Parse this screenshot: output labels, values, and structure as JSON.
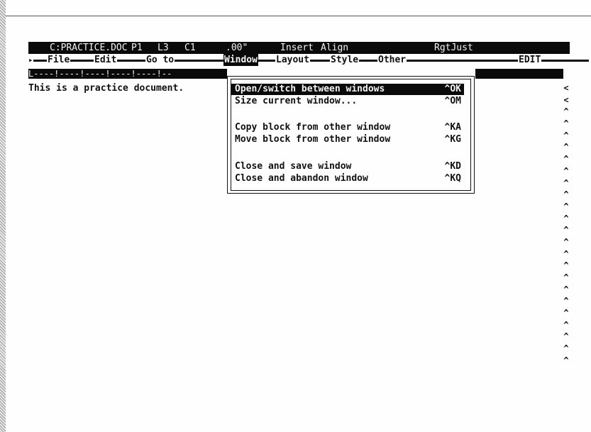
{
  "status_bar": {
    "file": "C:PRACTICE.DOC",
    "page": "P1",
    "line": "L3",
    "column": "C1",
    "position": ".00\"",
    "mode_insert": "Insert",
    "mode_align": "Align",
    "justify": "RgtJust"
  },
  "menu": {
    "start_marker": "▸",
    "items": [
      "File",
      "Edit",
      "Go to",
      "Window",
      "Layout",
      "Style",
      "Other"
    ],
    "active_index": 3,
    "mode_label": "EDIT"
  },
  "ruler": {
    "text": "L----!----!----!----!----!--"
  },
  "document": {
    "text": "This is a practice document."
  },
  "dropdown": {
    "items": [
      {
        "label": "Open/switch between windows",
        "shortcut": "^OK",
        "selected": true
      },
      {
        "label": "Size current window...",
        "shortcut": "^OM",
        "selected": false
      },
      {
        "label": "Copy block from other window",
        "shortcut": "^KA",
        "selected": false
      },
      {
        "label": "Move block from other window",
        "shortcut": "^KG",
        "selected": false
      },
      {
        "label": "Close and save window",
        "shortcut": "^KD",
        "selected": false
      },
      {
        "label": "Close and abandon window",
        "shortcut": "^KQ",
        "selected": false
      }
    ]
  },
  "right_margin_marks": [
    "<",
    "<",
    "^",
    "^",
    "^",
    "^",
    "^",
    "^",
    "^",
    "^",
    "^",
    "^",
    "^",
    "^",
    "^",
    "^",
    "^",
    "^",
    "^",
    "^",
    "^",
    "^",
    "^",
    "^"
  ],
  "colors": {
    "background": "#fefefe",
    "foreground": "#111111",
    "inverse_background": "#0a0a0a",
    "inverse_foreground": "#f4f4f4"
  }
}
